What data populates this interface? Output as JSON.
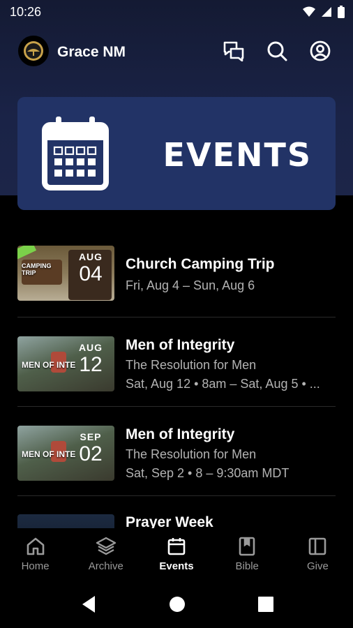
{
  "status": {
    "time": "10:26"
  },
  "header": {
    "title": "Grace NM"
  },
  "banner": {
    "title": "EVENTS"
  },
  "events": [
    {
      "title": "Church Camping Trip",
      "subtitle": "Fri, Aug 4 – Sun, Aug 6",
      "details": "",
      "month": "AUG",
      "day": "04",
      "thumb_label": "CAMPING TRIP"
    },
    {
      "title": "Men of Integrity",
      "subtitle": "The Resolution for Men",
      "details": "Sat, Aug 12 • 8am – Sat, Aug 5 • ...",
      "month": "AUG",
      "day": "12",
      "thumb_label": "MEN OF INTE"
    },
    {
      "title": "Men of Integrity",
      "subtitle": "The Resolution for Men",
      "details": "Sat, Sep 2 • 8 – 9:30am MDT",
      "month": "SEP",
      "day": "02",
      "thumb_label": "MEN OF INTE"
    },
    {
      "title": "Prayer Week",
      "subtitle": "",
      "details": "",
      "month": "",
      "day": "",
      "thumb_label": ""
    }
  ],
  "nav": [
    {
      "label": "Home",
      "icon": "home-icon",
      "active": false
    },
    {
      "label": "Archive",
      "icon": "layers-icon",
      "active": false
    },
    {
      "label": "Events",
      "icon": "calendar-icon",
      "active": true
    },
    {
      "label": "Bible",
      "icon": "book-icon",
      "active": false
    },
    {
      "label": "Give",
      "icon": "give-icon",
      "active": false
    }
  ],
  "colors": {
    "banner": "#223366",
    "accent_active": "#ffffff",
    "inactive": "#9a9a9a"
  }
}
